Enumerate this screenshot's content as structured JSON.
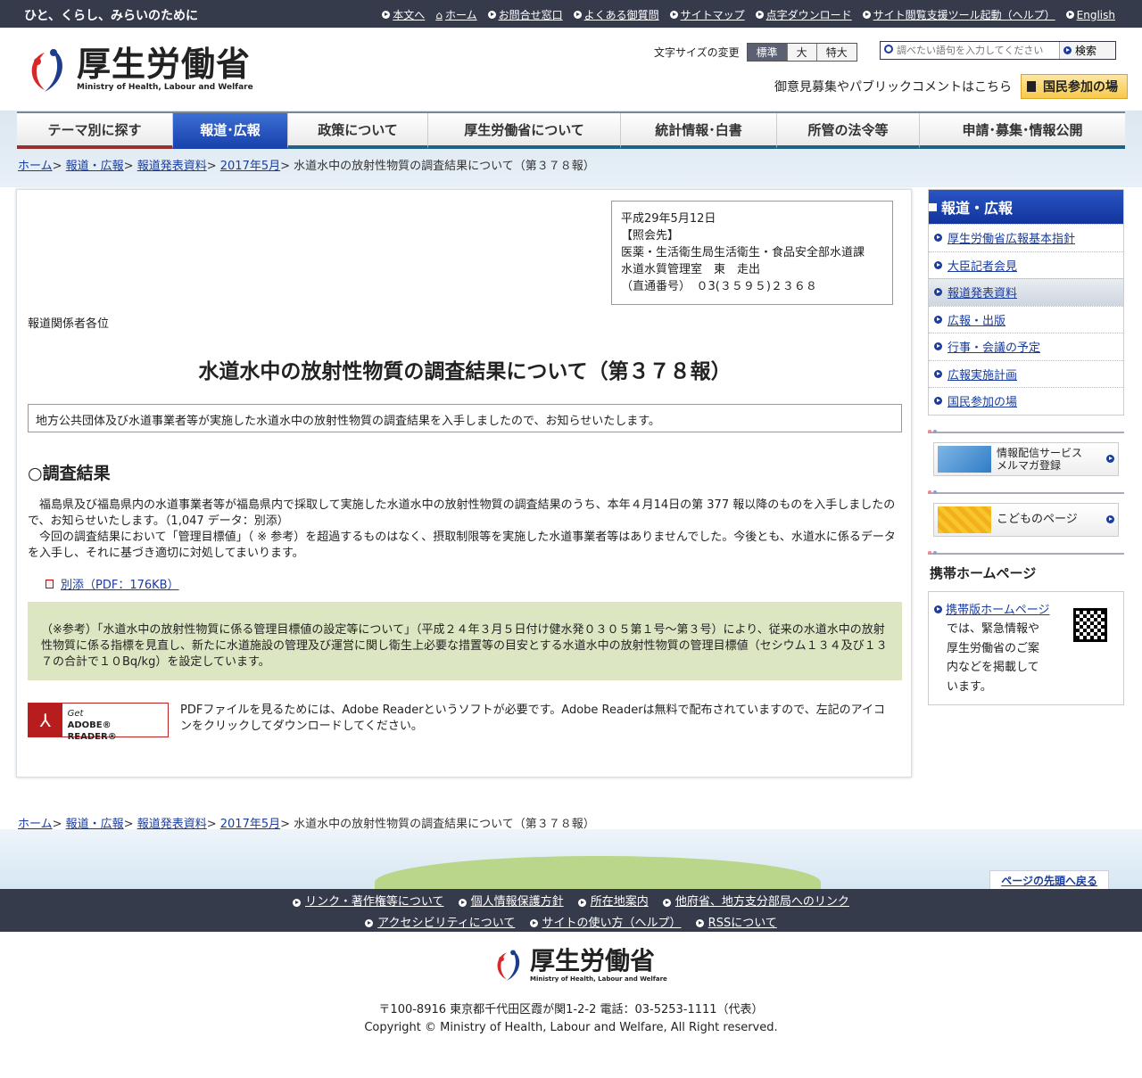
{
  "topbar": {
    "tagline": "ひと、くらし、みらいのために",
    "links": [
      "本文へ",
      "ホーム",
      "お問合せ窓口",
      "よくある御質問",
      "サイトマップ",
      "点字ダウンロード",
      "サイト閲覧支援ツール起動（ヘルプ）",
      "English"
    ]
  },
  "header": {
    "logo_title": "厚生労働省",
    "logo_sub": "Ministry of Health, Labour and Welfare",
    "font_size_label": "文字サイズの変更",
    "font_sizes": [
      "標準",
      "大",
      "特大"
    ],
    "search_placeholder": "調べたい語句を入力してください",
    "search_button": "検索",
    "public_comment": "御意見募集やパブリックコメントはこちら",
    "participation_button": "国民参加の場"
  },
  "nav": [
    "テーマ別に探す",
    "報道･広報",
    "政策について",
    "厚生労働省について",
    "統計情報･白書",
    "所管の法令等",
    "申請･募集･情報公開"
  ],
  "breadcrumb": {
    "links": [
      "ホーム",
      "報道・広報",
      "報道発表資料",
      "2017年5月"
    ],
    "current": "水道水中の放射性物質の調査結果について（第３７８報）"
  },
  "contact": [
    "平成29年5月12日",
    "【照会先】",
    "医薬・生活衛生局生活衛生・食品安全部水道課",
    "水道水質管理室　東　走出",
    "（直通番号）　０3(３５９５)２３６８"
  ],
  "addressee": "報道関係者各位",
  "title": "水道水中の放射性物質の調査結果について（第３７８報）",
  "summary": "地方公共団体及び水道事業者等が実施した水道水中の放射性物質の調査結果を入手しましたので、お知らせいたします。",
  "section_heading": "○調査結果",
  "body": [
    "　福島県及び福島県内の水道事業者等が福島県内で採取して実施した水道水中の放射性物質の調査結果のうち、本年４月14日の第 377 報以降のものを入手しましたので、お知らせいたします。（1,047 データ：別添）",
    "　今回の調査結果において「管理目標値」（ ※ 参考）を超過するものはなく、摂取制限等を実施した水道事業者等はありませんでした。今後とも、水道水に係るデータを入手し、それに基づき適切に対処してまいります。"
  ],
  "attachment": "別添（PDF：176KB）",
  "note": "（※参考）「水道水中の放射性物質に係る管理目標値の設定等について」（平成２４年３月５日付け健水発０３０５第１号～第３号）により、従来の水道水中の放射性物質に係る指標を見直し、新たに水道施設の管理及び運営に関し衛生上必要な措置等の目安とする水道水中の放射性物質の管理目標値（セシウム１３４及び１３７の合計で１０Bq/kg）を設定しています。",
  "reader": {
    "badge_get": "Get",
    "badge_name": "ADOBE® READER®",
    "text": "PDFファイルを見るためには、Adobe Readerというソフトが必要です。Adobe Readerは無料で配布されていますので、左記のアイコンをクリックしてダウンロードしてください。"
  },
  "sidebar": {
    "heading": "報道・広報",
    "items": [
      "厚生労働省広報基本指針",
      "大臣記者会見",
      "報道発表資料",
      "広報・出版",
      "行事・会議の予定",
      "広報実施計画",
      "国民参加の場"
    ],
    "mail_banner": "情報配信サービス\nメルマガ登録",
    "kids_banner": "こどものページ",
    "mobile_heading": "携帯ホームページ",
    "mobile_link": "携帯版ホームページ",
    "mobile_text": "では、緊急情報や厚生労働省のご案内などを掲載しています。"
  },
  "back_to_top": "ページの先頭へ戻る",
  "footer": {
    "links_row1": [
      "リンク・著作権等について",
      "個人情報保護方針",
      "所在地案内",
      "他府省、地方支分部局へのリンク"
    ],
    "links_row2": [
      "アクセシビリティについて",
      "サイトの使い方（ヘルプ）",
      "RSSについて"
    ],
    "address": "〒100-8916 東京都千代田区霞が関1-2-2 電話：03-5253-1111（代表）",
    "copyright": "Copyright © Ministry of Health, Labour and Welfare, All Right reserved."
  },
  "colors": {
    "topbar": "#363b4c",
    "nav_active": "#1a45b0",
    "note_bg": "#dde6c3"
  }
}
